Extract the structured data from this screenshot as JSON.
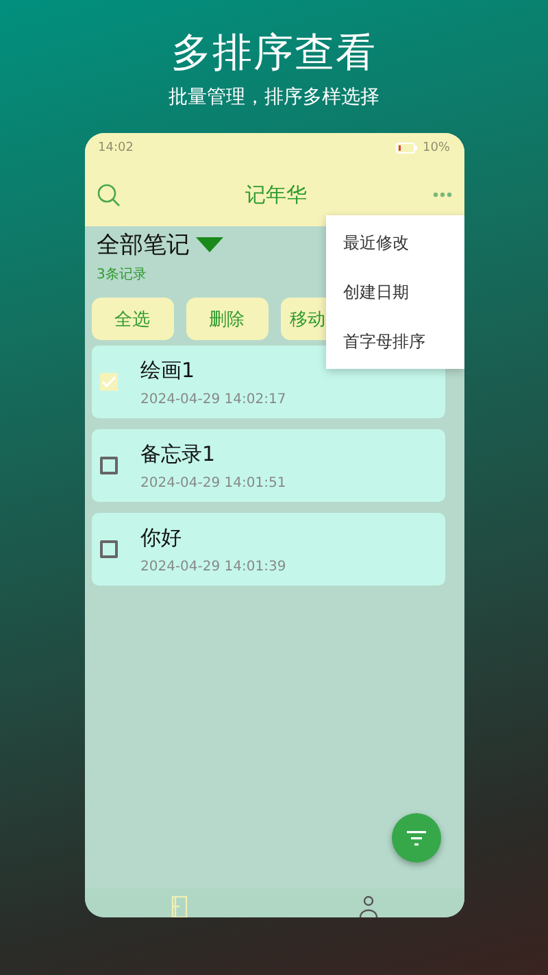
{
  "headline": "多排序查看",
  "subtitle": "批量管理，排序多样选择",
  "status_bar": {
    "time": "14:02",
    "battery": "10%"
  },
  "app_bar": {
    "title": "记年华"
  },
  "list_header": {
    "title": "全部笔记",
    "count": "3条记录"
  },
  "actions": [
    "全选",
    "删除",
    "移动"
  ],
  "notes": [
    {
      "title": "绘画1",
      "date": "2024-04-29 14:02:17",
      "checked": true
    },
    {
      "title": "备忘录1",
      "date": "2024-04-29 14:01:51",
      "checked": false
    },
    {
      "title": "你好",
      "date": "2024-04-29 14:01:39",
      "checked": false
    }
  ],
  "sort_menu": [
    "最近修改",
    "创建日期",
    "首字母排序"
  ],
  "bottom_nav": [
    {
      "kind": "notes",
      "selected": true
    },
    {
      "kind": "profile",
      "selected": false
    }
  ]
}
